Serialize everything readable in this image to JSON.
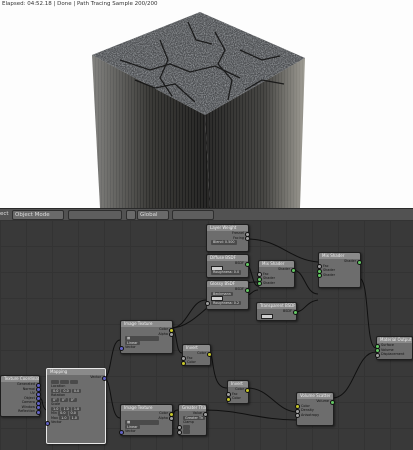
{
  "render": {
    "status": "Elapsed: 04:52.18 | Done | Path Tracing Sample 200/200"
  },
  "header": {
    "left_label": "ect",
    "mode": "Object Mode",
    "orientation": "Global"
  },
  "nodes": {
    "layer_weight": {
      "title": "Layer Weight",
      "out1": "Fresnel",
      "out2": "Facing",
      "field": "Blend: 0.500"
    },
    "diffuse": {
      "title": "Diffuse BSDF",
      "out": "BSDF",
      "field1": "Roughness: 0.0"
    },
    "glossy": {
      "title": "Glossy BSDF",
      "out": "BSDF",
      "sel": "Beckmann",
      "field1": "Roughness: 0.2"
    },
    "transparent": {
      "title": "Transparent BSDF",
      "out": "BSDF"
    },
    "mix1": {
      "title": "Mix Shader",
      "out": "Shader",
      "in1": "Fac",
      "in2": "Shader",
      "in3": "Shader"
    },
    "mix2": {
      "title": "Mix Shader",
      "out": "Shader",
      "in1": "Fac",
      "in2": "Shader",
      "in3": "Shader"
    },
    "material_output": {
      "title": "Material Output",
      "in1": "Surface",
      "in2": "Volume",
      "in3": "Displacement"
    },
    "image_tex1": {
      "title": "Image Texture",
      "out1": "Color",
      "out2": "Alpha",
      "field": "Linear",
      "in": "Vector"
    },
    "invert": {
      "title": "Invert",
      "out": "Color",
      "in1": "Fac",
      "in2": "Color"
    },
    "invert2": {
      "title": "Invert",
      "out": "Color",
      "in1": "Fac",
      "in2": "Color"
    },
    "mapping": {
      "title": "Mapping",
      "out": "Vector",
      "lbl1": "Location",
      "lbl2": "Rotation",
      "lbl3": "Scale",
      "min": "Min",
      "max": "Max",
      "in": "Vector"
    },
    "tex_coord": {
      "title": "Texture Coordinate",
      "o1": "Generated",
      "o2": "Normal",
      "o3": "UV",
      "o4": "Object",
      "o5": "Camera",
      "o6": "Window",
      "o7": "Reflection"
    },
    "image_tex2": {
      "title": "Image Texture",
      "out1": "Color",
      "out2": "Alpha",
      "field": "Linear",
      "in": "Vector"
    },
    "greater": {
      "title": "Greater Than",
      "out": "Value",
      "field": "Greater Th",
      "clamp": "Clamp"
    },
    "volume": {
      "title": "Volume Scatter",
      "out": "Volume",
      "in1": "Color",
      "in2": "Density",
      "in3": "Anisotropy"
    }
  },
  "colors": {
    "render_bg": "#fdfdfd",
    "editor_bg": "#393939",
    "node_body": "#6d6d6d",
    "link": "#101010"
  }
}
